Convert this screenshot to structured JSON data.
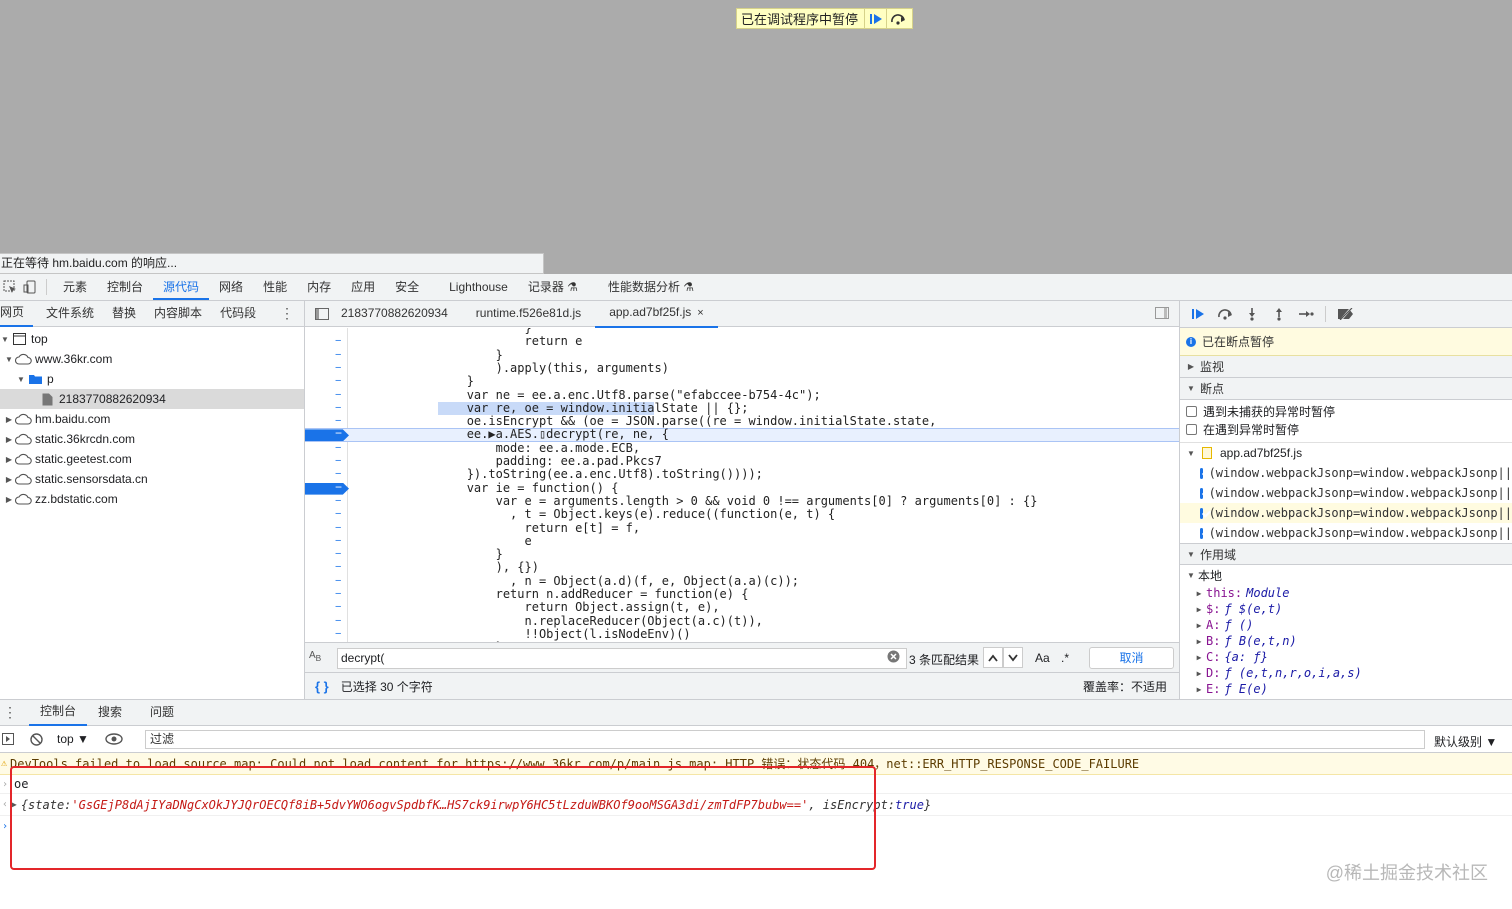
{
  "page": {
    "paused_banner": "已在调试程序中暂停",
    "status_bubble": "正在等待 hm.baidu.com 的响应..."
  },
  "main_tabs": [
    "元素",
    "控制台",
    "源代码",
    "网络",
    "性能",
    "内存",
    "应用",
    "安全",
    "Lighthouse",
    "记录器 ⚗",
    "性能数据分析 ⚗"
  ],
  "navigator": {
    "tabs": [
      "网页",
      "文件系统",
      "替换",
      "内容脚本",
      "代码段"
    ],
    "more": "⋮",
    "tree": [
      {
        "label": "top",
        "level": 0,
        "icon": "frame",
        "expanded": true
      },
      {
        "label": "www.36kr.com",
        "level": 1,
        "icon": "cloud",
        "expanded": true
      },
      {
        "label": "p",
        "level": 2,
        "icon": "folder",
        "expanded": true
      },
      {
        "label": "2183770882620934",
        "level": 3,
        "icon": "file",
        "selected": true
      },
      {
        "label": "hm.baidu.com",
        "level": 1,
        "icon": "cloud",
        "expanded": false
      },
      {
        "label": "static.36krcdn.com",
        "level": 1,
        "icon": "cloud",
        "expanded": false
      },
      {
        "label": "static.geetest.com",
        "level": 1,
        "icon": "cloud",
        "expanded": false
      },
      {
        "label": "static.sensorsdata.cn",
        "level": 1,
        "icon": "cloud",
        "expanded": false
      },
      {
        "label": "zz.bdstatic.com",
        "level": 1,
        "icon": "cloud",
        "expanded": false
      }
    ]
  },
  "editor": {
    "tabs": [
      {
        "label": "2183770882620934"
      },
      {
        "label": "runtime.f526e81d.js"
      },
      {
        "label": "app.ad7bf25f.js",
        "active": true,
        "close": "×"
      }
    ],
    "lines": [
      "                    }",
      "                    return e",
      "                }",
      "                ).apply(this, arguments)",
      "            }",
      "            var ne = ee.a.enc.Utf8.parse(\"efabccee-b754-4c\");",
      "            var re, oe = window.initialState || {};",
      "            oe.isEncrypt && (oe = JSON.parse((re = window.initialState.state,",
      "            ee.▶a.AES.▯decrypt(re, ne, {",
      "                mode: ee.a.mode.ECB,",
      "                padding: ee.a.pad.Pkcs7",
      "            }).toString(ee.a.enc.Utf8).toString())));",
      "            var ie = function() {",
      "                var e = arguments.length > 0 && void 0 !== arguments[0] ? arguments[0] : {}",
      "                  , t = Object.keys(e).reduce((function(e, t) {",
      "                    return e[t] = f,",
      "                    e",
      "                }",
      "                ), {})",
      "                  , n = Object(a.d)(f, e, Object(a.a)(c));",
      "                return n.addReducer = function(e) {",
      "                    return Object.assign(t, e),",
      "                    n.replaceReducer(Object(a.c)(t)),",
      "                    !!Object(l.isNodeEnv)()",
      "                }"
    ],
    "search": {
      "value": "decrypt(",
      "results": "3 条匹配结果",
      "case": "Aa",
      "regex": ".*",
      "cancel": "取消"
    },
    "status": {
      "selection": "已选择 30 个字符",
      "coverage": "覆盖率：不适用",
      "braces": "{ }"
    }
  },
  "sidebar": {
    "paused_msg": "已在断点暂停",
    "watch": "监视",
    "breakpoints": "断点",
    "pause_uncaught": "遇到未捕获的异常时暂停",
    "pause_caught": "在遇到异常时暂停",
    "bp_file": "app.ad7bf25f.js",
    "bp_items": [
      "(window.webpackJsonp=window.webpackJsonp||",
      "(window.webpackJsonp=window.webpackJsonp||",
      "(window.webpackJsonp=window.webpackJsonp||",
      "(window.webpackJsonp=window.webpackJsonp||"
    ],
    "scope": "作用域",
    "local": "本地",
    "scope_rows": [
      {
        "k": "this:",
        "v": "Module"
      },
      {
        "k": "$:",
        "v": "ƒ $(e,t)"
      },
      {
        "k": "A:",
        "v": "ƒ ()"
      },
      {
        "k": "B:",
        "v": "ƒ B(e,t,n)"
      },
      {
        "k": "C:",
        "v": "{a: ƒ}"
      },
      {
        "k": "D:",
        "v": "ƒ (e,t,n,r,o,i,a,s)"
      },
      {
        "k": "E:",
        "v": "ƒ E(e)"
      }
    ]
  },
  "drawer": {
    "tabs": [
      "控制台",
      "搜索",
      "问题"
    ],
    "context": "top ▼",
    "filter_placeholder": "过滤",
    "level": "默认级别 ▼",
    "warning": "DevTools failed to load source map: Could not load content for https://www.36kr.com/p/main.js.map: HTTP 错误：状态代码 404，net::ERR_HTTP_RESPONSE_CODE_FAILURE",
    "input_echo": "oe",
    "result_prefix": "{state: ",
    "result_string": "'GsGEjP8dAjIYaDNgCxOkJYJQrOECQf8iB+5dvYWO6ogvSpdbfK…HS7ck9irwpY6HC5tLzduWBKOf9ooMSGA3di/zmTdFP7bubw=='",
    "result_suffix_key": ", isEncrypt: ",
    "result_suffix_val": "true",
    "result_end": "}"
  },
  "watermark": "@稀土掘金技术社区",
  "colors": {
    "accent": "#1a73e8",
    "highlight_box": "#e3262a"
  }
}
